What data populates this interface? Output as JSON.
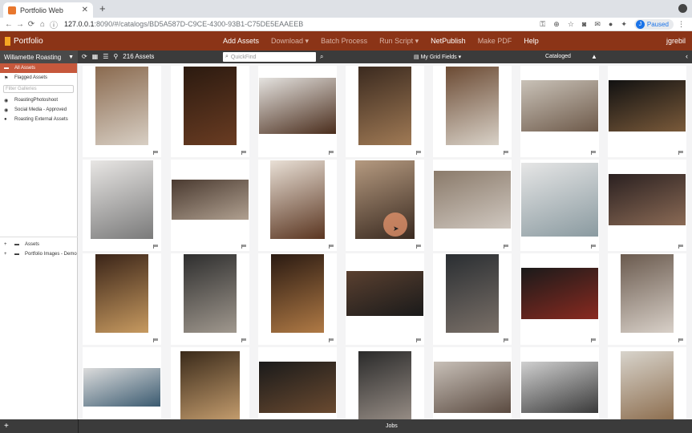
{
  "browser": {
    "tab_title": "Portfolio Web",
    "url_host": "127.0.0.1",
    "url_path": ":8090/#/catalogs/BD5A587D-C9CE-4300-93B1-C75DE5EAAEEB",
    "profile_initial": "J",
    "profile_status": "Paused"
  },
  "app": {
    "logo_text": "Portfolio",
    "user": "jgrebil",
    "menu": [
      {
        "label": "Add Assets",
        "dim": false
      },
      {
        "label": "Download ▾",
        "dim": true
      },
      {
        "label": "Batch Process",
        "dim": true
      },
      {
        "label": "Run Script ▾",
        "dim": true
      },
      {
        "label": "NetPublish",
        "dim": false
      },
      {
        "label": "Make PDF",
        "dim": true
      },
      {
        "label": "Help",
        "dim": false
      }
    ]
  },
  "toolbar": {
    "catalog": "Willamette Roasting",
    "asset_count": "216 Assets",
    "quickfind_placeholder": "QuickFind",
    "grid_fields": "My Grid Fields",
    "sort_field": "Cataloged"
  },
  "sidebar": {
    "items": [
      {
        "label": "All Assets",
        "icon": "folder-icon",
        "active": true
      },
      {
        "label": "Flagged Assets",
        "icon": "flag-icon",
        "active": false
      }
    ],
    "filter_placeholder": "Filter Galleries",
    "galleries": [
      {
        "label": "RoastingPhotoshoot",
        "icon": "eye-icon"
      },
      {
        "label": "Social Media - Approved",
        "icon": "eye-icon"
      },
      {
        "label": "Roasting External Assets",
        "icon": "person-icon"
      }
    ],
    "tree": [
      {
        "label": "Assets"
      },
      {
        "label": "Portfolio Images - Demo"
      }
    ]
  },
  "footer": {
    "jobs": "Jobs"
  },
  "grid": {
    "thumbs": [
      {
        "w": 66,
        "h": 98,
        "c1": "#8a6a4f",
        "c2": "#d8cfc4"
      },
      {
        "w": 66,
        "h": 98,
        "c1": "#2b1a10",
        "c2": "#6a3c22"
      },
      {
        "w": 96,
        "h": 70,
        "c1": "#e5e3e0",
        "c2": "#4a2d1c"
      },
      {
        "w": 66,
        "h": 98,
        "c1": "#3b2a1f",
        "c2": "#a07a55"
      },
      {
        "w": 66,
        "h": 98,
        "c1": "#6b4a33",
        "c2": "#d9d2c8"
      },
      {
        "w": 96,
        "h": 64,
        "c1": "#c9c2b8",
        "c2": "#6e5a4a"
      },
      {
        "w": 96,
        "h": 64,
        "c1": "#111111",
        "c2": "#7a5a3a"
      },
      {
        "w": 78,
        "h": 98,
        "c1": "#e8e6e4",
        "c2": "#7a7a7a"
      },
      {
        "w": 96,
        "h": 50,
        "c1": "#4a3a30",
        "c2": "#b0a090"
      },
      {
        "w": 68,
        "h": 98,
        "c1": "#e9e0d6",
        "c2": "#5a3520"
      },
      {
        "w": 74,
        "h": 98,
        "c1": "#b59a80",
        "c2": "#3a2a20"
      },
      {
        "w": 96,
        "h": 72,
        "c1": "#8a7a6a",
        "c2": "#d0c8c0"
      },
      {
        "w": 96,
        "h": 92,
        "c1": "#e6e6e6",
        "c2": "#8a9aa0"
      },
      {
        "w": 96,
        "h": 64,
        "c1": "#2a2020",
        "c2": "#8a6a55"
      },
      {
        "w": 66,
        "h": 98,
        "c1": "#3a2418",
        "c2": "#c79a60"
      },
      {
        "w": 66,
        "h": 98,
        "c1": "#2e2e2e",
        "c2": "#a0988e"
      },
      {
        "w": 66,
        "h": 98,
        "c1": "#2a1a12",
        "c2": "#b07a45"
      },
      {
        "w": 96,
        "h": 56,
        "c1": "#5a4030",
        "c2": "#1a1a1a"
      },
      {
        "w": 66,
        "h": 98,
        "c1": "#2a2e32",
        "c2": "#7a7068"
      },
      {
        "w": 96,
        "h": 64,
        "c1": "#1a1a1a",
        "c2": "#8a2a20"
      },
      {
        "w": 66,
        "h": 98,
        "c1": "#6a5a4e",
        "c2": "#d8d0c8"
      },
      {
        "w": 96,
        "h": 48,
        "c1": "#dcdcdc",
        "c2": "#3a5a70"
      },
      {
        "w": 74,
        "h": 90,
        "c1": "#3a2a1a",
        "c2": "#c8a070"
      },
      {
        "w": 96,
        "h": 64,
        "c1": "#1a1a1a",
        "c2": "#6a4a30"
      },
      {
        "w": 66,
        "h": 90,
        "c1": "#2a2a2a",
        "c2": "#9a9088"
      },
      {
        "w": 96,
        "h": 64,
        "c1": "#c8c0b8",
        "c2": "#5a4a40"
      },
      {
        "w": 96,
        "h": 64,
        "c1": "#d0d0d0",
        "c2": "#3a3a3a"
      },
      {
        "w": 66,
        "h": 90,
        "c1": "#d8d4cc",
        "c2": "#8a6a4a"
      }
    ]
  }
}
